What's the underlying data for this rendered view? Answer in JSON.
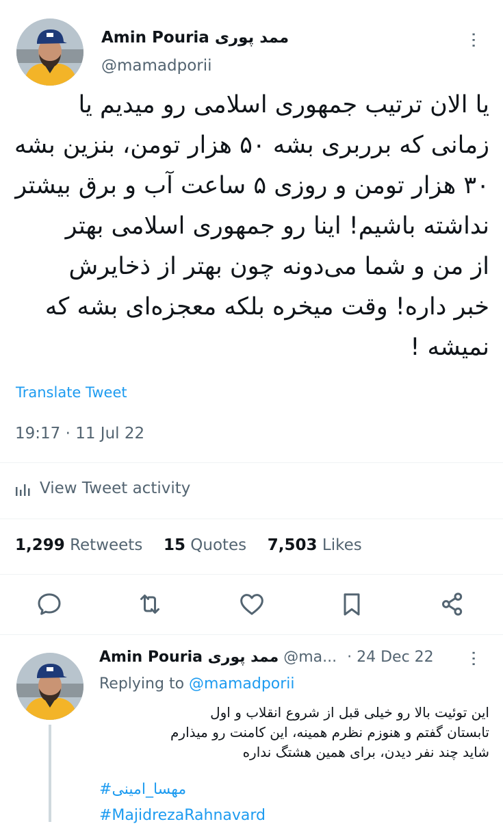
{
  "tweet": {
    "author_name": "Amin Pouria ممد پوری",
    "author_handle": "@mamadporii",
    "more_label": "···",
    "lines": [
      "یا الان ترتیب جمهوری اسلامی رو میدیم یا",
      "زمانی که برربری بشه ۵۰ هزار تومن، بنزین بشه",
      "۳۰ هزار تومن و روزی ۵ ساعت آب و برق بیشتر",
      "نداشته باشیم! اینا رو جمهوری اسلامی بهتر",
      "از من و شما می‌دونه چون بهتر از ذخایرش",
      "خبر داره! وقت میخره بلکه معجزه‌ای بشه که",
      "نمیشه !"
    ],
    "translate_label": "Translate Tweet",
    "timestamp": "19:17 · 11 Jul 22",
    "activity_label": "View Tweet activity",
    "stats": {
      "retweets_count": "1,299",
      "retweets_label": "Retweets",
      "quotes_count": "15",
      "quotes_label": "Quotes",
      "likes_count": "7,503",
      "likes_label": "Likes"
    },
    "actions": [
      "reply-icon",
      "retweet-icon",
      "like-icon",
      "bookmark-icon",
      "share-icon"
    ]
  },
  "reply": {
    "author_name": "Amin Pouria ممد پوری",
    "author_handle": "@ma...",
    "date": "· 24 Dec 22",
    "more_label": "···",
    "replying_prefix": "Replying to",
    "replying_handle": "@mamadporii",
    "lines": [
      "این توئیت بالا رو خیلی قبل از شروع انقلاب و اول",
      "تابستان گفتم و هنوزم نظرم همینه، این کامنت رو میذارم",
      "شاید چند نفر دیدن، برای همین هشتگ نداره"
    ],
    "hashtags": [
      "#مهسا_امینی",
      "#MajidrezaRahnavard"
    ]
  }
}
